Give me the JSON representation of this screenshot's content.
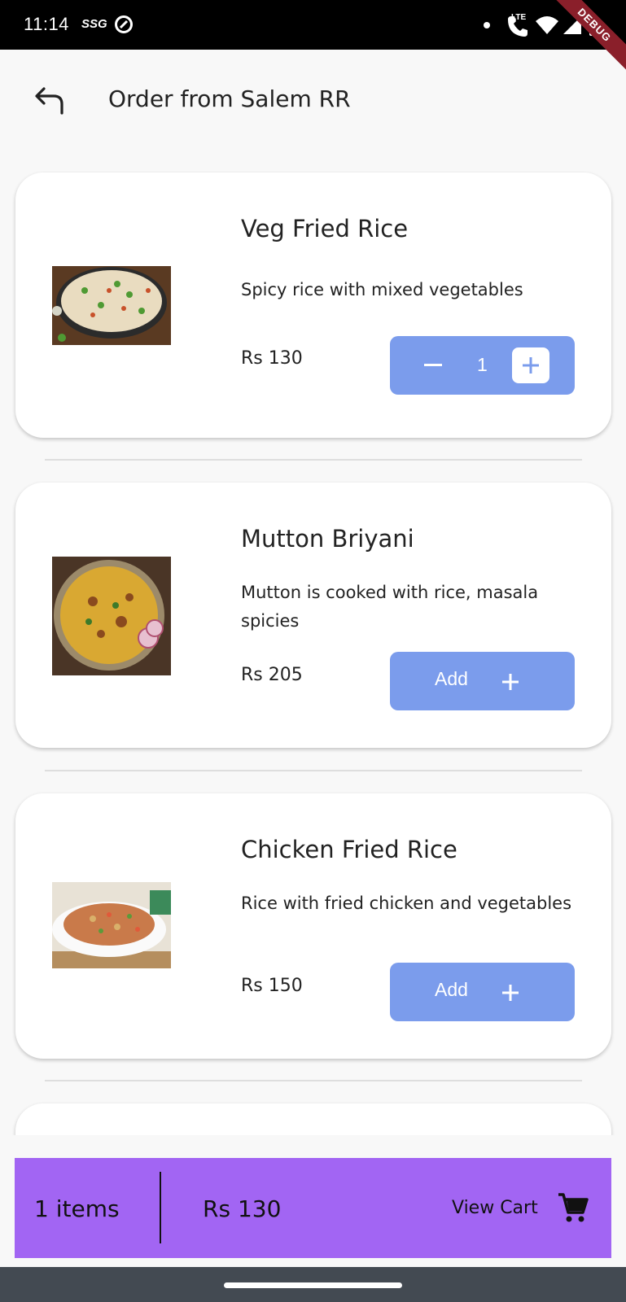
{
  "status_bar": {
    "time": "11:14",
    "carrier_badge": "SSG",
    "network": "LTE",
    "debug_label": "DEBUG"
  },
  "header": {
    "title": "Order from Salem RR",
    "back_icon": "back-arrow-icon"
  },
  "items": [
    {
      "name": "Veg Fried Rice",
      "description": "Spicy rice with mixed vegetables",
      "price": "Rs  130",
      "quantity": "1",
      "in_cart": true
    },
    {
      "name": "Mutton Briyani",
      "description": "Mutton is cooked with rice, masala spicies",
      "price": "Rs  205",
      "add_label": "Add",
      "in_cart": false
    },
    {
      "name": "Chicken Fried Rice",
      "description": "Rice with fried chicken and vegetables",
      "price": "Rs  150",
      "add_label": "Add",
      "in_cart": false
    }
  ],
  "cart_bar": {
    "item_count": "1 items",
    "total": "Rs 130",
    "view_cart_label": "View Cart",
    "cart_icon": "shopping-cart-icon"
  },
  "colors": {
    "button_blue": "#7b9cec",
    "cart_bar_purple": "#a265f3"
  }
}
